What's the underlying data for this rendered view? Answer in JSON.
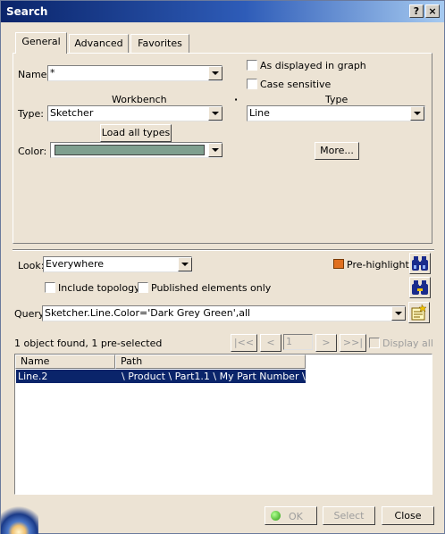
{
  "window": {
    "title": "Search",
    "help_label": "?",
    "close_label": "×"
  },
  "tabs": [
    {
      "label": "General"
    },
    {
      "label": "Advanced"
    },
    {
      "label": "Favorites"
    }
  ],
  "general": {
    "name_label": "Name:",
    "name_value": "*",
    "as_displayed_label": "As displayed in graph",
    "case_sensitive_label": "Case sensitive",
    "workbench_header": "Workbench",
    "type_header": "Type",
    "type_label": "Type:",
    "workbench_value": "Sketcher",
    "type_value": "Line",
    "load_all_types_label": "Load all types",
    "color_label": "Color:",
    "color_swatch": "#7f9f8f",
    "more_label": "More..."
  },
  "look": {
    "label": "Look:",
    "value": "Everywhere",
    "prehighlight_label": "Pre-highlight"
  },
  "options": {
    "include_topology_label": "Include topology",
    "published_only_label": "Published elements only"
  },
  "query": {
    "label": "Query:",
    "value": "Sketcher.Line.Color='Dark Grey Green',all"
  },
  "status": {
    "text": "1 object found, 1 pre-selected"
  },
  "pager": {
    "first": "|<<",
    "prev": "<",
    "page": "1",
    "next": ">",
    "last": ">>|",
    "display_all_label": "Display all"
  },
  "results": {
    "columns": [
      "Name",
      "Path"
    ],
    "rows": [
      {
        "name": "Line.2",
        "path": "\\ Product \\ Part1.1 \\ My Part Number \\..."
      }
    ]
  },
  "footer": {
    "ok_label": "OK",
    "select_label": "Select",
    "close_label": "Close"
  },
  "colors": {
    "selection": "#0a246a",
    "accent_prehighlight": "#e07020"
  }
}
